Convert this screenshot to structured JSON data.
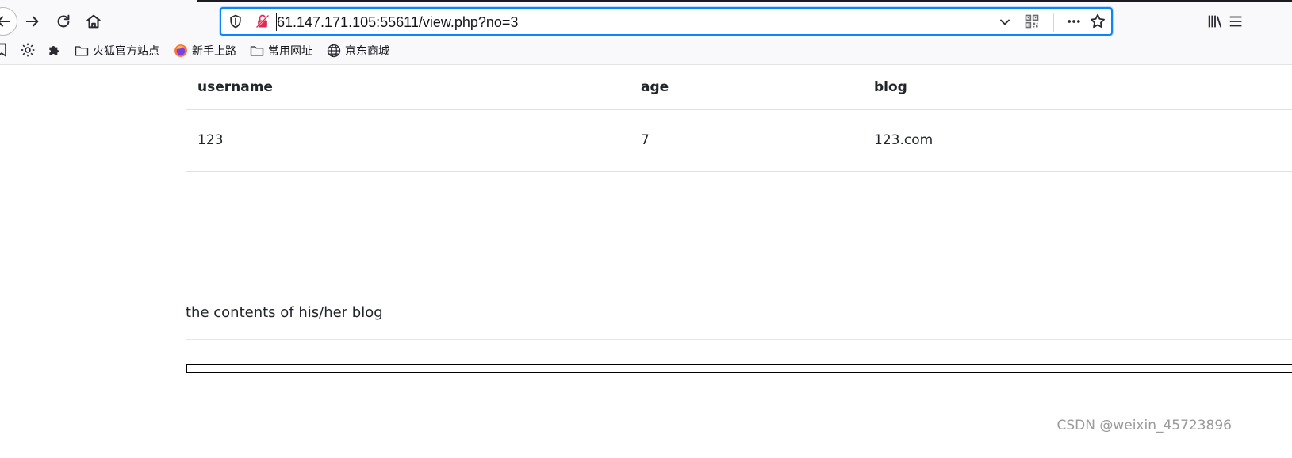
{
  "browser": {
    "url": "61.147.171.105:55611/view.php?no=3",
    "bookmarks": [
      {
        "label": "火狐官方站点",
        "icon": "folder-icon"
      },
      {
        "label": "新手上路",
        "icon": "firefox-icon"
      },
      {
        "label": "常用网址",
        "icon": "folder-icon"
      },
      {
        "label": "京东商城",
        "icon": "globe-icon"
      }
    ],
    "accent_color": "#0a84ff"
  },
  "table": {
    "headers": [
      "username",
      "age",
      "blog"
    ],
    "rows": [
      {
        "username": "123",
        "age": "7",
        "blog": "123.com"
      }
    ]
  },
  "blog_section": {
    "caption": "the contents of his/her blog"
  },
  "watermark": "CSDN @weixin_45723896"
}
